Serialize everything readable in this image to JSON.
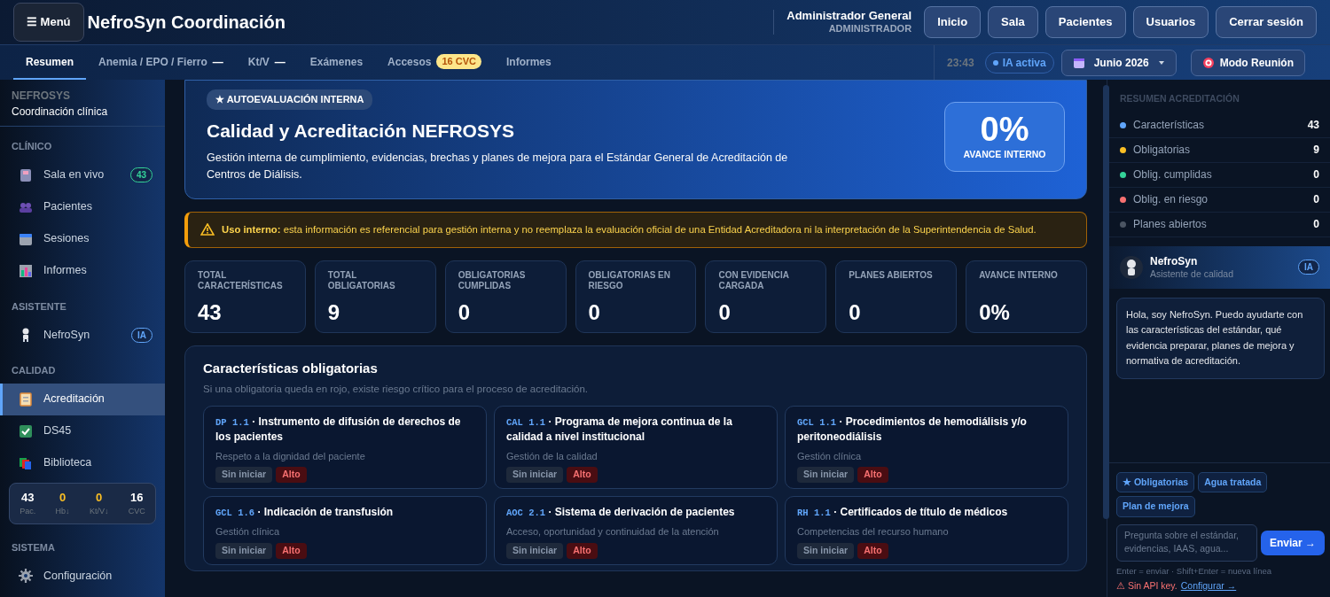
{
  "header": {
    "menu_button": {
      "icon": "☰",
      "label": "Menú"
    },
    "title": "NefroSyn Coordinación",
    "user": {
      "name": "Administrador General",
      "role": "ADMINISTRADOR"
    },
    "nav_buttons": [
      "Inicio",
      "Sala",
      "Pacientes",
      "Usuarios",
      "Cerrar sesión"
    ]
  },
  "tabs": [
    {
      "label": "Resumen",
      "selected": true
    },
    {
      "label": "Anemia / EPO / Fierro",
      "selected": false,
      "indicator": "—"
    },
    {
      "label": "Kt/V",
      "selected": false,
      "indicator": "—"
    },
    {
      "label": "Exámenes",
      "selected": false
    },
    {
      "label": "Accesos",
      "selected": false,
      "badge": "16 CVC"
    },
    {
      "label": "Informes",
      "selected": false
    }
  ],
  "toolbar": {
    "time": "23:43",
    "ai_status": "IA activa",
    "month": "Junio 2026",
    "meeting_button": "Modo Reunión"
  },
  "sidebar": {
    "brand": {
      "name": "NEFROSYS",
      "subtitle": "Coordinación clínica"
    },
    "groups": [
      {
        "kind": "section",
        "title": "CLÍNICO",
        "items": [
          {
            "label": "Sala en vivo",
            "selected": false,
            "badge": {
              "text": "43",
              "color": "#34d399"
            }
          },
          {
            "label": "Pacientes",
            "selected": false
          },
          {
            "label": "Sesiones",
            "selected": false
          },
          {
            "label": "Informes",
            "selected": false
          }
        ]
      },
      {
        "kind": "section",
        "title": "ASISTENTE",
        "items": [
          {
            "label": "NefroSyn",
            "selected": false,
            "badge": {
              "text": "IA",
              "color": "#60a5fa"
            }
          }
        ]
      },
      {
        "kind": "section",
        "title": "CALIDAD",
        "items": [
          {
            "label": "Acreditación",
            "selected": true
          },
          {
            "label": "DS45",
            "selected": false
          },
          {
            "label": "Biblioteca",
            "selected": false
          }
        ]
      },
      {
        "kind": "stats",
        "items": [
          {
            "value": "43",
            "label": "Pac.",
            "color": "#ffffff"
          },
          {
            "value": "0",
            "label": "Hb↓",
            "color": "#fbbf24"
          },
          {
            "value": "0",
            "label": "Kt/V↓",
            "color": "#fbbf24"
          },
          {
            "value": "16",
            "label": "CVC",
            "color": "#ffffff"
          }
        ]
      },
      {
        "kind": "section",
        "title": "SISTEMA",
        "items": [
          {
            "label": "Configuración",
            "selected": false
          }
        ]
      }
    ]
  },
  "hero": {
    "tag": "★ AUTOEVALUACIÓN INTERNA",
    "title": "Calidad y Acreditación NEFROSYS",
    "description": "Gestión interna de cumplimiento, evidencias, brechas y planes de mejora para el Estándar General de Acreditación de Centros de Diálisis.",
    "progress": {
      "value": "0%",
      "label": "AVANCE INTERNO"
    }
  },
  "alert": "**Uso interno:** esta información es referencial para gestión interna y no reemplaza la evaluación oficial de una Entidad Acreditadora ni la interpretación de la Superintendencia de Salud.",
  "stats": [
    {
      "label": "TOTAL CARACTERÍSTICAS",
      "value": "43"
    },
    {
      "label": "TOTAL OBLIGATORIAS",
      "value": "9"
    },
    {
      "label": "OBLIGATORIAS CUMPLIDAS",
      "value": "0"
    },
    {
      "label": "OBLIGATORIAS EN RIESGO",
      "value": "0"
    },
    {
      "label": "CON EVIDENCIA CARGADA",
      "value": "0"
    },
    {
      "label": "PLANES ABIERTOS",
      "value": "0"
    },
    {
      "label": "AVANCE INTERNO",
      "value": "0%"
    }
  ],
  "requirements": {
    "title": "Características obligatorias",
    "subtitle": "Si una obligatoria queda en rojo, existe riesgo crítico para el proceso de acreditación.",
    "cards": [
      {
        "code": "DP 1.1",
        "title": "· Instrumento de difusión de derechos de los pacientes",
        "area": "Respeto a la dignidad del paciente",
        "status": "Sin iniciar",
        "risk": "Alto"
      },
      {
        "code": "CAL 1.1",
        "title": "· Programa de mejora continua de la calidad a nivel institucional",
        "area": "Gestión de la calidad",
        "status": "Sin iniciar",
        "risk": "Alto"
      },
      {
        "code": "GCL 1.1",
        "title": "· Procedimientos de hemodiálisis y/o peritoneodiálisis",
        "area": "Gestión clínica",
        "status": "Sin iniciar",
        "risk": "Alto"
      },
      {
        "code": "GCL 1.6",
        "title": "· Indicación de transfusión",
        "area": "Gestión clínica",
        "status": "Sin iniciar",
        "risk": "Alto"
      },
      {
        "code": "AOC 2.1",
        "title": "· Sistema de derivación de pacientes",
        "area": "Acceso, oportunidad y continuidad de la atención",
        "status": "Sin iniciar",
        "risk": "Alto"
      },
      {
        "code": "RH 1.1",
        "title": "· Certificados de título de médicos",
        "area": "Competencias del recurso humano",
        "status": "Sin iniciar",
        "risk": "Alto"
      }
    ]
  },
  "summary": {
    "title": "RESUMEN ACREDITACIÓN",
    "items": [
      {
        "label": "Características",
        "value": "43",
        "color": "#60a5fa"
      },
      {
        "label": "Obligatorias",
        "value": "9",
        "color": "#fbbf24"
      },
      {
        "label": "Oblig. cumplidas",
        "value": "0",
        "color": "#34d399"
      },
      {
        "label": "Oblig. en riesgo",
        "value": "0",
        "color": "#f87171"
      },
      {
        "label": "Planes abiertos",
        "value": "0",
        "color": "#4b5563"
      }
    ]
  },
  "assistant": {
    "name": "NefroSyn",
    "subtitle": "Asistente de calidad",
    "badge": "IA",
    "message": "Hola, soy NefroSyn. Puedo ayudarte con las características del estándar, qué evidencia preparar, planes de mejora y normativa de acreditación.",
    "chips": [
      "★ Obligatorias",
      "Agua tratada",
      "Plan de mejora"
    ],
    "input": {
      "placeholder": "Pregunta sobre el estándar, evidencias, IAAS, agua..."
    },
    "send_button": "Enviar →",
    "hint": "Enter = enviar · Shift+Enter = nueva línea",
    "warning": "⚠ Sin API key.",
    "link": "Configurar →"
  }
}
